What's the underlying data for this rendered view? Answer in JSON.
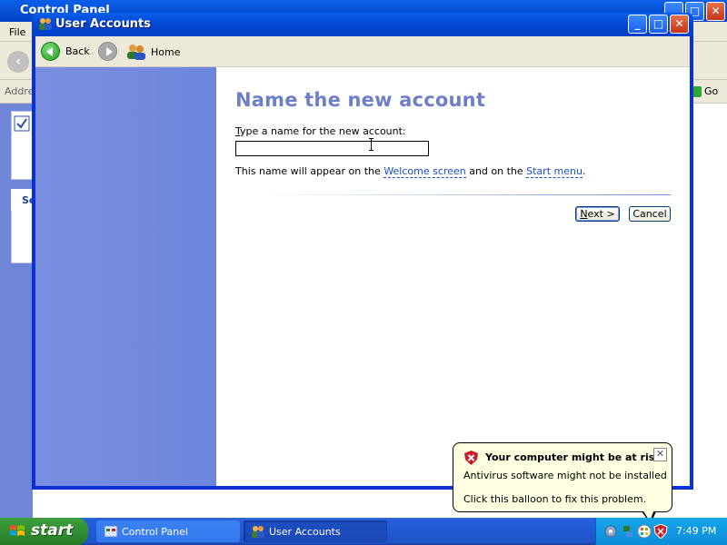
{
  "background_window": {
    "title": "Control Panel",
    "menu_first": "File",
    "address_label": "Address",
    "go_label": "Go",
    "panel_heading_fragment": "Se"
  },
  "window": {
    "title": "User Accounts"
  },
  "nav": {
    "back_label": "Back",
    "home_label": "Home"
  },
  "page": {
    "heading": "Name the new account",
    "prompt_underlined": "T",
    "prompt_rest": "ype a name for the new account:",
    "name_value": "",
    "info_prefix": "This name will appear on the ",
    "info_link1": "Welcome screen",
    "info_middle": " and on the ",
    "info_link2": "Start menu",
    "info_suffix": "."
  },
  "buttons": {
    "next_underlined": "N",
    "next_rest": "ext >",
    "cancel": "Cancel"
  },
  "balloon": {
    "title": "Your computer might be at risk",
    "line1": "Antivirus software might not be installed",
    "line2": "Click this balloon to fix this problem.",
    "close_glyph": "✕"
  },
  "taskbar": {
    "start_label": "start",
    "tasks": [
      {
        "label": "Control Panel",
        "active": false
      },
      {
        "label": "User Accounts",
        "active": true
      }
    ],
    "clock": "7:49 PM"
  },
  "colors": {
    "heading": "#6d7fc9",
    "sidebar": "#7a8ee0",
    "title_bar": "#0246d1",
    "balloon_bg": "#ffffe1",
    "link": "#1a4ec2"
  }
}
